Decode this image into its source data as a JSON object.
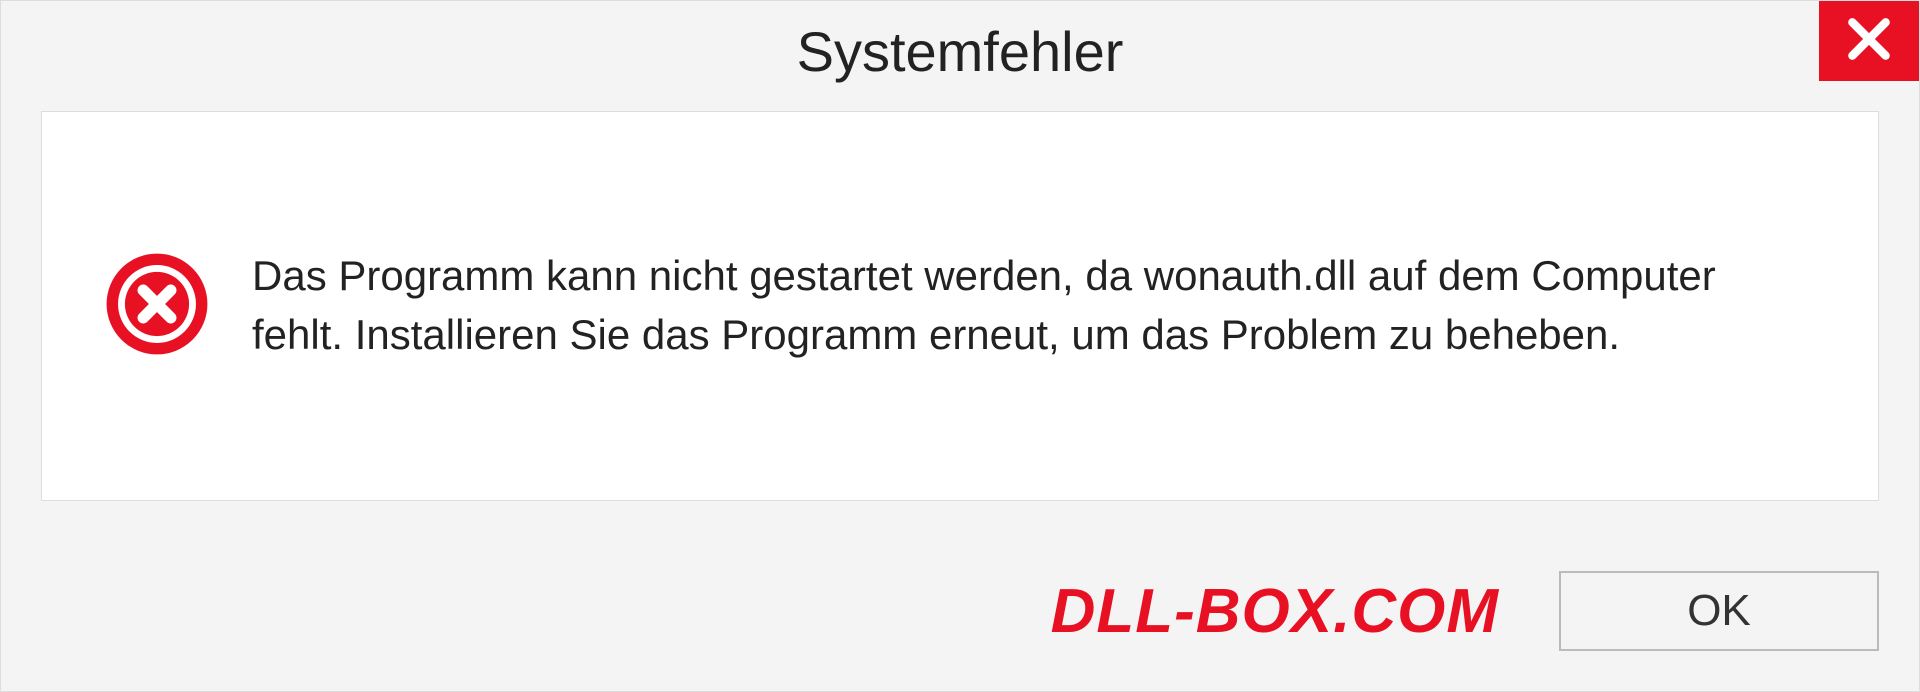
{
  "titlebar": {
    "title": "Systemfehler"
  },
  "content": {
    "message": "Das Programm kann nicht gestartet werden, da wonauth.dll auf dem Computer fehlt. Installieren Sie das Programm erneut, um das Problem zu beheben."
  },
  "footer": {
    "watermark": "DLL-BOX.COM",
    "ok_label": "OK"
  },
  "colors": {
    "close_red": "#e81123",
    "error_red": "#e81123"
  }
}
